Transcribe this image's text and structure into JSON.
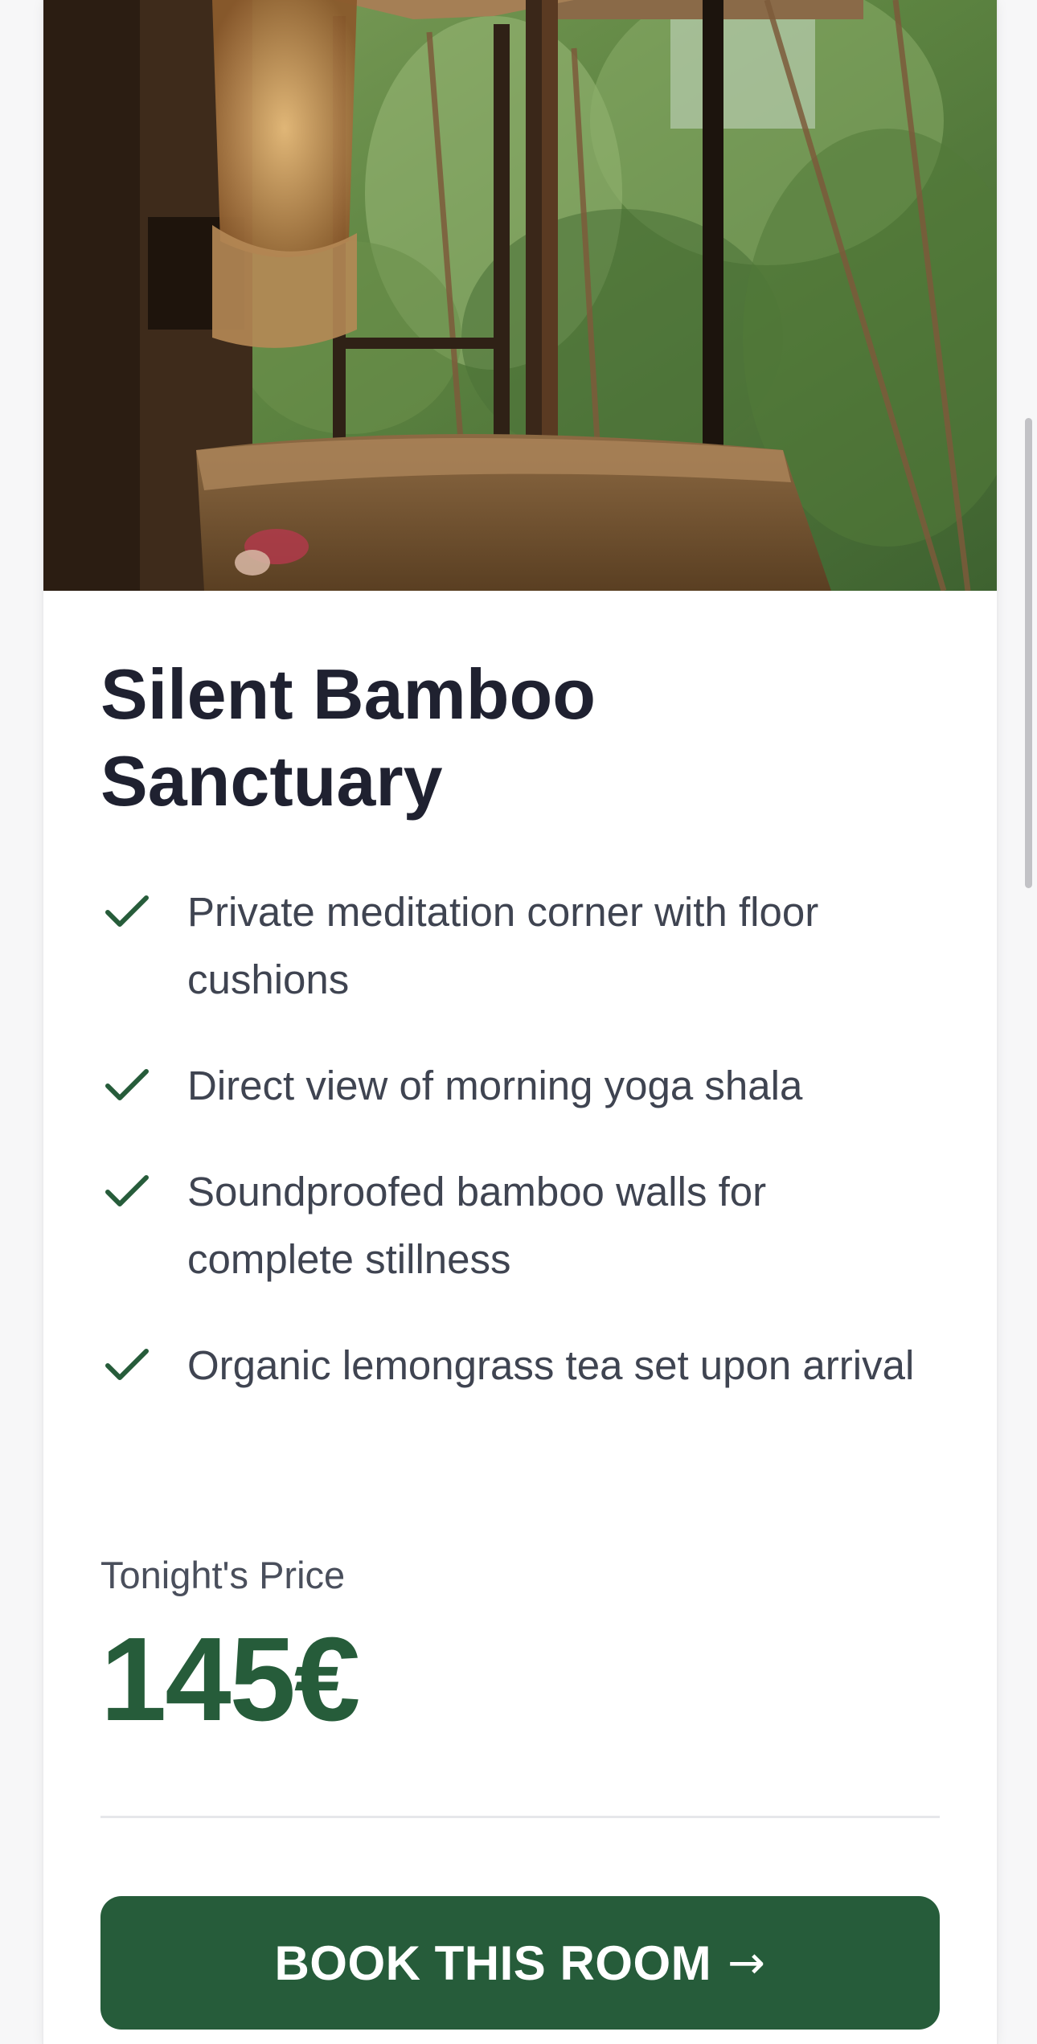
{
  "room": {
    "title": "Silent Bamboo Sanctuary",
    "features": [
      "Private meditation corner with floor cushions",
      "Direct view of morning yoga shala",
      "Soundproofed bamboo walls for complete stillness",
      "Organic lemongrass tea set upon arrival"
    ]
  },
  "price": {
    "label": "Tonight's Price",
    "value": "145€"
  },
  "actions": {
    "book_label": "BOOK THIS ROOM",
    "book_arrow": "→"
  },
  "icons": {
    "feature_check": "check-icon"
  },
  "colors": {
    "accent": "#265c3a",
    "title": "#1f2130",
    "text": "#3f4451"
  }
}
